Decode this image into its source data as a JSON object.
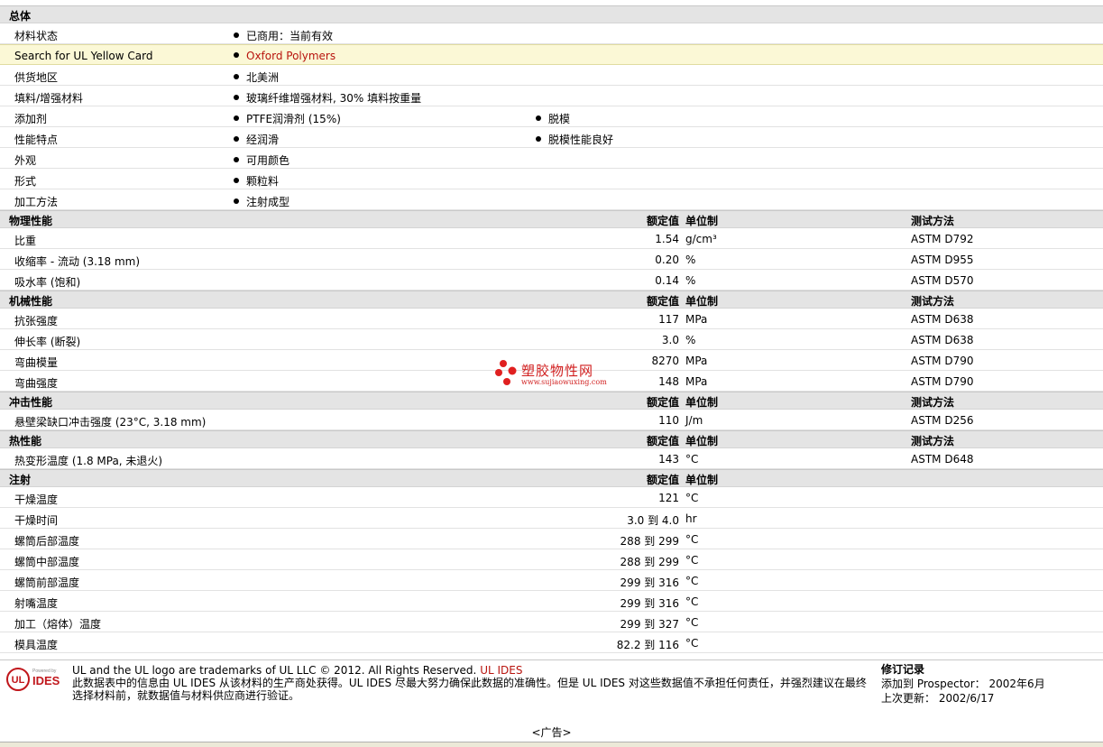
{
  "general": {
    "title": "总体",
    "rows": [
      {
        "label": "材料状态",
        "b1": "已商用：当前有效",
        "b2": ""
      },
      {
        "label": "Search for UL Yellow Card",
        "b1": "Oxford Polymers",
        "b2": ""
      },
      {
        "label": "供货地区",
        "b1": "北美洲",
        "b2": ""
      },
      {
        "label": "填料/增强材料",
        "b1": "玻璃纤维增强材料, 30% 填料按重量",
        "b2": ""
      },
      {
        "label": "添加剂",
        "b1": "PTFE润滑剂 (15%)",
        "b2": "脱模"
      },
      {
        "label": "性能特点",
        "b1": "经润滑",
        "b2": "脱模性能良好"
      },
      {
        "label": "外观",
        "b1": "可用颜色",
        "b2": ""
      },
      {
        "label": "形式",
        "b1": "颗粒料",
        "b2": ""
      },
      {
        "label": "加工方法",
        "b1": "注射成型",
        "b2": ""
      }
    ]
  },
  "headers": {
    "rated": "额定值",
    "unit": "单位制",
    "test": "测试方法"
  },
  "physical": {
    "title": "物理性能",
    "rows": [
      {
        "label": "比重",
        "val": "1.54",
        "unit": "g/cm³",
        "test": "ASTM D792"
      },
      {
        "label": "收缩率 - 流动 (3.18 mm)",
        "val": "0.20",
        "unit": "%",
        "test": "ASTM D955"
      },
      {
        "label": "吸水率 (饱和)",
        "val": "0.14",
        "unit": "%",
        "test": "ASTM D570"
      }
    ]
  },
  "mechanical": {
    "title": "机械性能",
    "rows": [
      {
        "label": "抗张强度",
        "val": "117",
        "unit": "MPa",
        "test": "ASTM D638"
      },
      {
        "label": "伸长率 (断裂)",
        "val": "3.0",
        "unit": "%",
        "test": "ASTM D638"
      },
      {
        "label": "弯曲模量",
        "val": "8270",
        "unit": "MPa",
        "test": "ASTM D790"
      },
      {
        "label": "弯曲强度",
        "val": "148",
        "unit": "MPa",
        "test": "ASTM D790"
      }
    ]
  },
  "impact": {
    "title": "冲击性能",
    "rows": [
      {
        "label": "悬壁梁缺口冲击强度 (23°C, 3.18 mm)",
        "val": "110",
        "unit": "J/m",
        "test": "ASTM D256"
      }
    ]
  },
  "thermal": {
    "title": "热性能",
    "rows": [
      {
        "label": "热变形温度 (1.8 MPa, 未退火)",
        "val": "143",
        "unit": "°C",
        "test": "ASTM D648"
      }
    ]
  },
  "injection": {
    "title": "注射",
    "rows": [
      {
        "label": "干燥温度",
        "val": "121",
        "unit": "°C"
      },
      {
        "label": "干燥时间",
        "val": "3.0 到  4.0",
        "unit": "hr"
      },
      {
        "label": "螺筒后部温度",
        "val": "288 到  299",
        "unit": "°C"
      },
      {
        "label": "螺筒中部温度",
        "val": "288 到  299",
        "unit": "°C"
      },
      {
        "label": "螺筒前部温度",
        "val": "299 到  316",
        "unit": "°C"
      },
      {
        "label": "射嘴温度",
        "val": "299 到  316",
        "unit": "°C"
      },
      {
        "label": "加工（熔体）温度",
        "val": "299 到  327",
        "unit": "°C"
      },
      {
        "label": "模具温度",
        "val": "82.2 到  116",
        "unit": "°C"
      }
    ]
  },
  "watermark": {
    "title": "塑胶物性网",
    "url": "www.sujiaowuxing.com"
  },
  "footer": {
    "logo_small": "Powered by",
    "logo_ul": "UL",
    "logo_ides": "IDES",
    "trademark": "UL and the UL logo are trademarks of UL LLC © 2012. All Rights Reserved.",
    "trademark_link": "UL IDES",
    "disclaimer": "此数据表中的信息由 UL IDES 从该材料的生产商处获得。UL IDES 尽最大努力确保此数据的准确性。但是 UL IDES 对这些数据值不承担任何责任，并强烈建议在最终选择材料前，就数据值与材料供应商进行验证。",
    "revision_title": "修订记录",
    "added_label": "添加到 Prospector：",
    "added_value": "2002年6月",
    "updated_label": "上次更新：",
    "updated_value": "2002/6/17"
  },
  "ad": "<广告>",
  "colors": {
    "accent_red": "#b8140e",
    "highlight": "#fbf8d6",
    "section_bg": "#e4e4e4"
  }
}
